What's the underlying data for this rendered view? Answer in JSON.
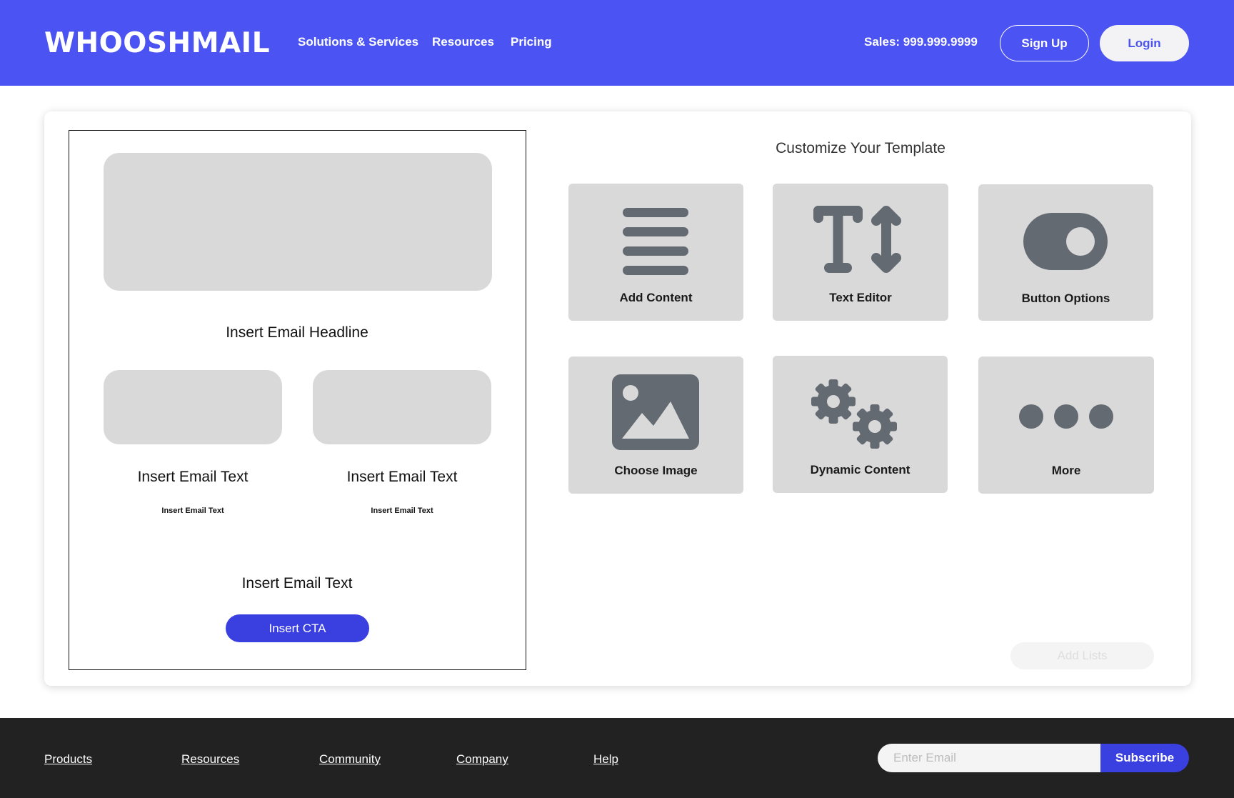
{
  "header": {
    "logo": "WHOOSHMAIL",
    "nav": [
      "Solutions & Services",
      "Resources",
      "Pricing"
    ],
    "sales": "Sales: 999.999.9999",
    "signup_label": "Sign Up",
    "login_label": "Login"
  },
  "preview": {
    "headline": "Insert Email Headline",
    "columns": [
      {
        "title": "Insert Email Text",
        "subtext": "Insert Email Text"
      },
      {
        "title": "Insert Email Text",
        "subtext": "Insert Email Text"
      }
    ],
    "bottom_text": "Insert Email Text",
    "cta_label": "Insert CTA"
  },
  "customize": {
    "title": "Customize Your Template",
    "tools": [
      {
        "label": "Add Content",
        "icon": "lines-icon"
      },
      {
        "label": "Text Editor",
        "icon": "text-height-icon"
      },
      {
        "label": "Button Options",
        "icon": "toggle-icon"
      },
      {
        "label": "Choose Image",
        "icon": "image-icon"
      },
      {
        "label": "Dynamic Content",
        "icon": "gears-icon"
      },
      {
        "label": "More",
        "icon": "ellipsis-icon"
      }
    ],
    "add_lists_label": "Add Lists"
  },
  "footer": {
    "links": [
      "Products",
      "Resources",
      "Community",
      "Company",
      "Help"
    ],
    "email_placeholder": "Enter Email",
    "subscribe_label": "Subscribe"
  },
  "colors": {
    "brand": "#4b53f2",
    "cta": "#3a3fe0",
    "tile": "#d9d9d9",
    "icon": "#646a72",
    "footer": "#222222"
  }
}
